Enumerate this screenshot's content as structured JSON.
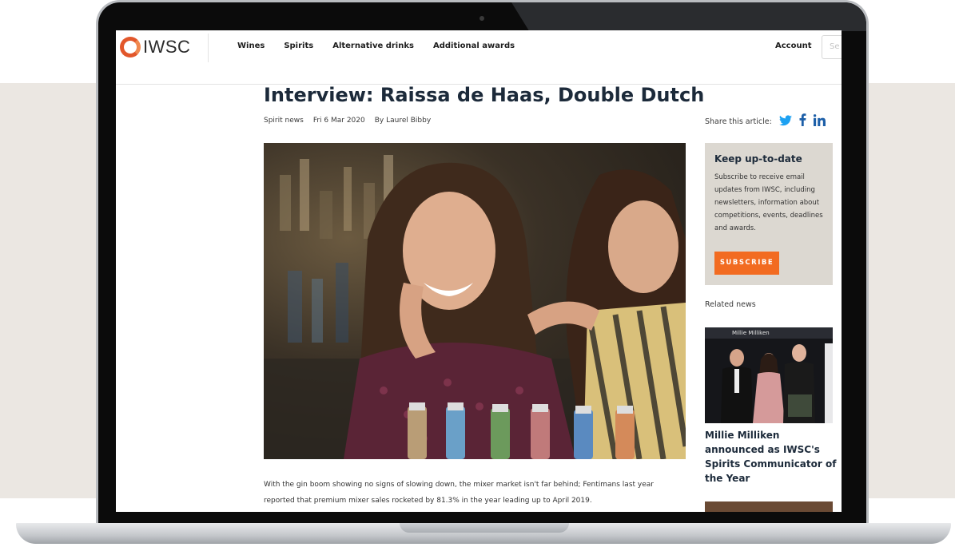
{
  "nav": {
    "logo": "IWSC",
    "links": [
      "Wines",
      "Spirits",
      "Alternative drinks",
      "Additional awards"
    ],
    "account": "Account",
    "search_placeholder": "Se"
  },
  "article": {
    "title": "Interview: Raissa de Haas, Double Dutch",
    "category": "Spirit news",
    "date": "Fri 6 Mar 2020",
    "author": "By Laurel Bibby",
    "body_line_1": "With the gin boom showing no signs of slowing down, the mixer market isn't far behind; Fentimans last year",
    "body_line_2": "reported that premium mixer sales rocketed by 81.3% in the year leading up to April 2019."
  },
  "share": {
    "label": "Share this article:",
    "icons": [
      "twitter-icon",
      "facebook-icon",
      "linkedin-icon"
    ]
  },
  "newsletter": {
    "title": "Keep up-to-date",
    "text": "Subscribe to receive email updates from IWSC, including newsletters, information about competitions, events, deadlines and awards.",
    "button": "SUBSCRIBE"
  },
  "related": {
    "label": "Related news",
    "image_caption": "Millie Milliken",
    "title": "Millie Milliken announced as IWSC's Spirits Communicator of the Year"
  },
  "colors": {
    "accent": "#f26b21",
    "heading": "#1c2a3a",
    "newsletter_bg": "#dcd8d1",
    "band_bg": "#ebe7e2"
  }
}
